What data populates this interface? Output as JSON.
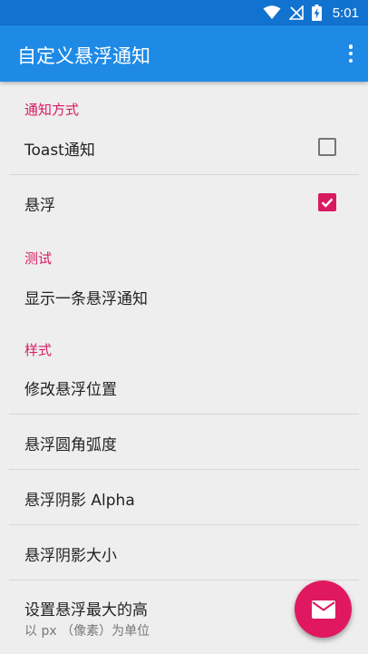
{
  "status_bar": {
    "time": "5:01",
    "icons": [
      "wifi-icon",
      "no-signal-icon",
      "battery-charging-icon"
    ]
  },
  "app_bar": {
    "title": "自定义悬浮通知",
    "menu_icon": "more-vert-icon"
  },
  "sections": {
    "notify_mode": {
      "header": "通知方式",
      "toast_label": "Toast通知",
      "toast_checked": false,
      "float_label": "悬浮",
      "float_checked": true
    },
    "test": {
      "header": "测试",
      "show_one": "显示一条悬浮通知"
    },
    "style": {
      "header": "样式",
      "position": "修改悬浮位置",
      "corner_radius": "悬浮圆角弧度",
      "shadow_alpha": "悬浮阴影 Alpha",
      "shadow_size": "悬浮阴影大小",
      "max_height": "设置悬浮最大的高",
      "max_height_summary": "以 px （像素）为单位"
    }
  },
  "fab": {
    "icon": "email-icon"
  },
  "colors": {
    "status_bar": "#1272cf",
    "app_bar": "#1e8ae6",
    "accent": "#d81b60"
  }
}
